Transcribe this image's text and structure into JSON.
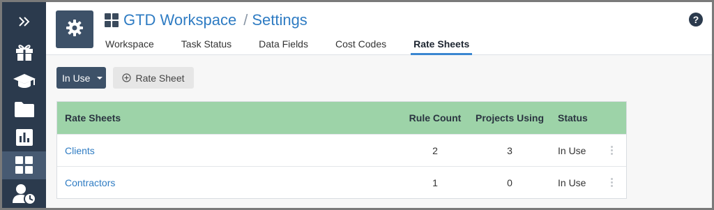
{
  "sidebar": {
    "items": [
      {
        "icon": "expand-icon"
      },
      {
        "icon": "gift-icon"
      },
      {
        "icon": "graduation-cap-icon"
      },
      {
        "icon": "folder-icon"
      },
      {
        "icon": "bar-chart-icon"
      },
      {
        "icon": "grid-icon",
        "active": true
      },
      {
        "icon": "user-clock-icon"
      }
    ]
  },
  "header": {
    "workspace": "GTD Workspace",
    "separator": "/",
    "page": "Settings",
    "help_label": "?",
    "tabs": [
      {
        "label": "Workspace"
      },
      {
        "label": "Task Status"
      },
      {
        "label": "Data Fields"
      },
      {
        "label": "Cost Codes"
      },
      {
        "label": "Rate Sheets",
        "active": true
      }
    ]
  },
  "toolbar": {
    "filter_label": "In Use",
    "add_label": "Rate Sheet"
  },
  "table": {
    "columns": [
      "Rate Sheets",
      "Rule Count",
      "Projects Using",
      "Status"
    ],
    "rows": [
      {
        "name": "Clients",
        "rule_count": "2",
        "projects_using": "3",
        "status": "In Use"
      },
      {
        "name": "Contractors",
        "rule_count": "1",
        "projects_using": "0",
        "status": "In Use"
      }
    ]
  },
  "colors": {
    "sidebar": "#2b3a4d",
    "accent": "#2f7cc3",
    "table_header": "#9dd3a8"
  }
}
